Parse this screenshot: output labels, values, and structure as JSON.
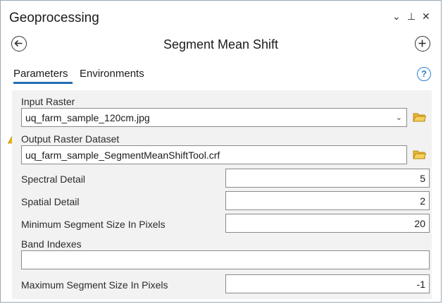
{
  "window": {
    "title": "Geoprocessing",
    "controls": {
      "menu": "⌄",
      "pin": "⊥",
      "close": "✕"
    }
  },
  "header": {
    "tool_title": "Segment Mean Shift"
  },
  "tabs": [
    {
      "label": "Parameters",
      "active": true
    },
    {
      "label": "Environments",
      "active": false
    }
  ],
  "help_label": "?",
  "params": {
    "input_raster": {
      "label": "Input Raster",
      "value": "uq_farm_sample_120cm.jpg"
    },
    "output_raster": {
      "label": "Output Raster Dataset",
      "value": "uq_farm_sample_SegmentMeanShiftTool.crf",
      "warning": true
    },
    "spectral_detail": {
      "label": "Spectral Detail",
      "value": "5"
    },
    "spatial_detail": {
      "label": "Spatial Detail",
      "value": "2"
    },
    "min_segment_size": {
      "label": "Minimum Segment Size In Pixels",
      "value": "20"
    },
    "band_indexes": {
      "label": "Band Indexes",
      "value": ""
    },
    "max_segment_size": {
      "label": "Maximum Segment Size In Pixels",
      "value": "-1"
    }
  },
  "colors": {
    "accent": "#1f6fb5",
    "folder": "#e8b739",
    "warning": "#f0b400",
    "form_bg": "#f2f2f2"
  },
  "icons": {
    "back": "back-arrow-icon",
    "add": "plus-icon",
    "help": "help-icon",
    "browse": "folder-icon",
    "warning": "warning-icon"
  }
}
